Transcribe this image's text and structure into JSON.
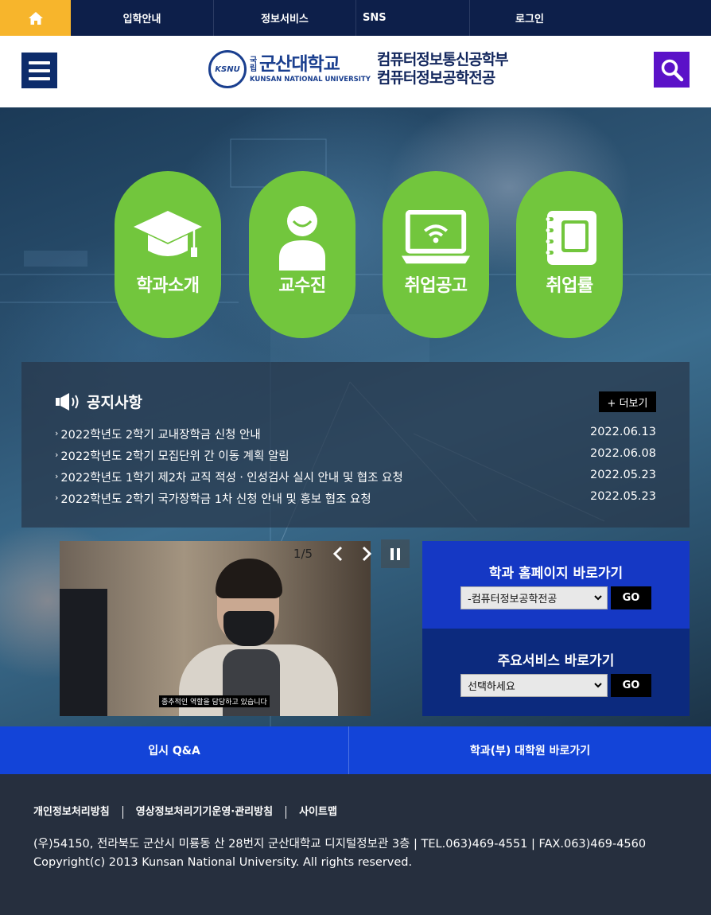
{
  "topnav": {
    "items": [
      "입학안내",
      "정보서비스",
      "SNS",
      "로그인"
    ]
  },
  "header": {
    "logo_emblem": "KSNU",
    "univ_prefix": "국립",
    "univ_name": "군산대학교",
    "univ_en": "KUNSAN NATIONAL UNIVERSITY",
    "dept_line1": "컴퓨터정보통신공학부",
    "dept_line2": "컴퓨터정보공학전공"
  },
  "circles": [
    {
      "label": "학과소개",
      "icon": "graduation-cap-icon"
    },
    {
      "label": "교수진",
      "icon": "person-icon"
    },
    {
      "label": "취업공고",
      "icon": "laptop-wifi-icon"
    },
    {
      "label": "취업률",
      "icon": "notebook-icon"
    }
  ],
  "notice": {
    "title": "공지사항",
    "more_label": "+ 더보기",
    "items": [
      {
        "title": "2022학년도 2학기 교내장학금 신청 안내",
        "date": "2022.06.13"
      },
      {
        "title": "2022학년도 2학기 모집단위 간 이동 계획 알림",
        "date": "2022.06.08"
      },
      {
        "title": "2022학년도 1학기 제2차 교직 적성ㆍ인성검사 실시 안내 및 협조 요청",
        "date": "2022.05.23"
      },
      {
        "title": "2022학년도 2학기 국가장학금 1차 신청 안내 및 홍보 협조 요청",
        "date": "2022.05.23"
      }
    ]
  },
  "slider": {
    "counter": "1/5",
    "caption": "종추적인 역할을 담당하고 있습니다"
  },
  "quick": {
    "dept": {
      "title": "학과 홈페이지 바로가기",
      "selected": "-컴퓨터정보공학전공",
      "go": "GO",
      "bg": "#1538c4"
    },
    "service": {
      "title": "주요서비스 바로가기",
      "selected": "선택하세요",
      "go": "GO",
      "bg": "#0c2a7e"
    }
  },
  "bottombar": {
    "left": "입시 Q&A",
    "right": "학과(부) 대학원 바로가기"
  },
  "footer": {
    "links": [
      "개인정보처리방침",
      "영상정보처리기기운영·관리방침",
      "사이트맵"
    ],
    "address": "(우)54150, 전라북도 군산시 미룡동 산 28번지 군산대학교 디지털정보관 3층 | TEL.063)469-4551 | FAX.063)469-4560",
    "copyright": "Copyright(c) 2013 Kunsan National University. All rights reserved."
  },
  "colors": {
    "topnav_bg": "#0d1f4a",
    "home_bg": "#f7b52c",
    "circle_green": "#72c63d",
    "search_bg": "#5b12c8",
    "bottombar_bg": "#1344d8",
    "footer_bg": "#262f3e"
  }
}
